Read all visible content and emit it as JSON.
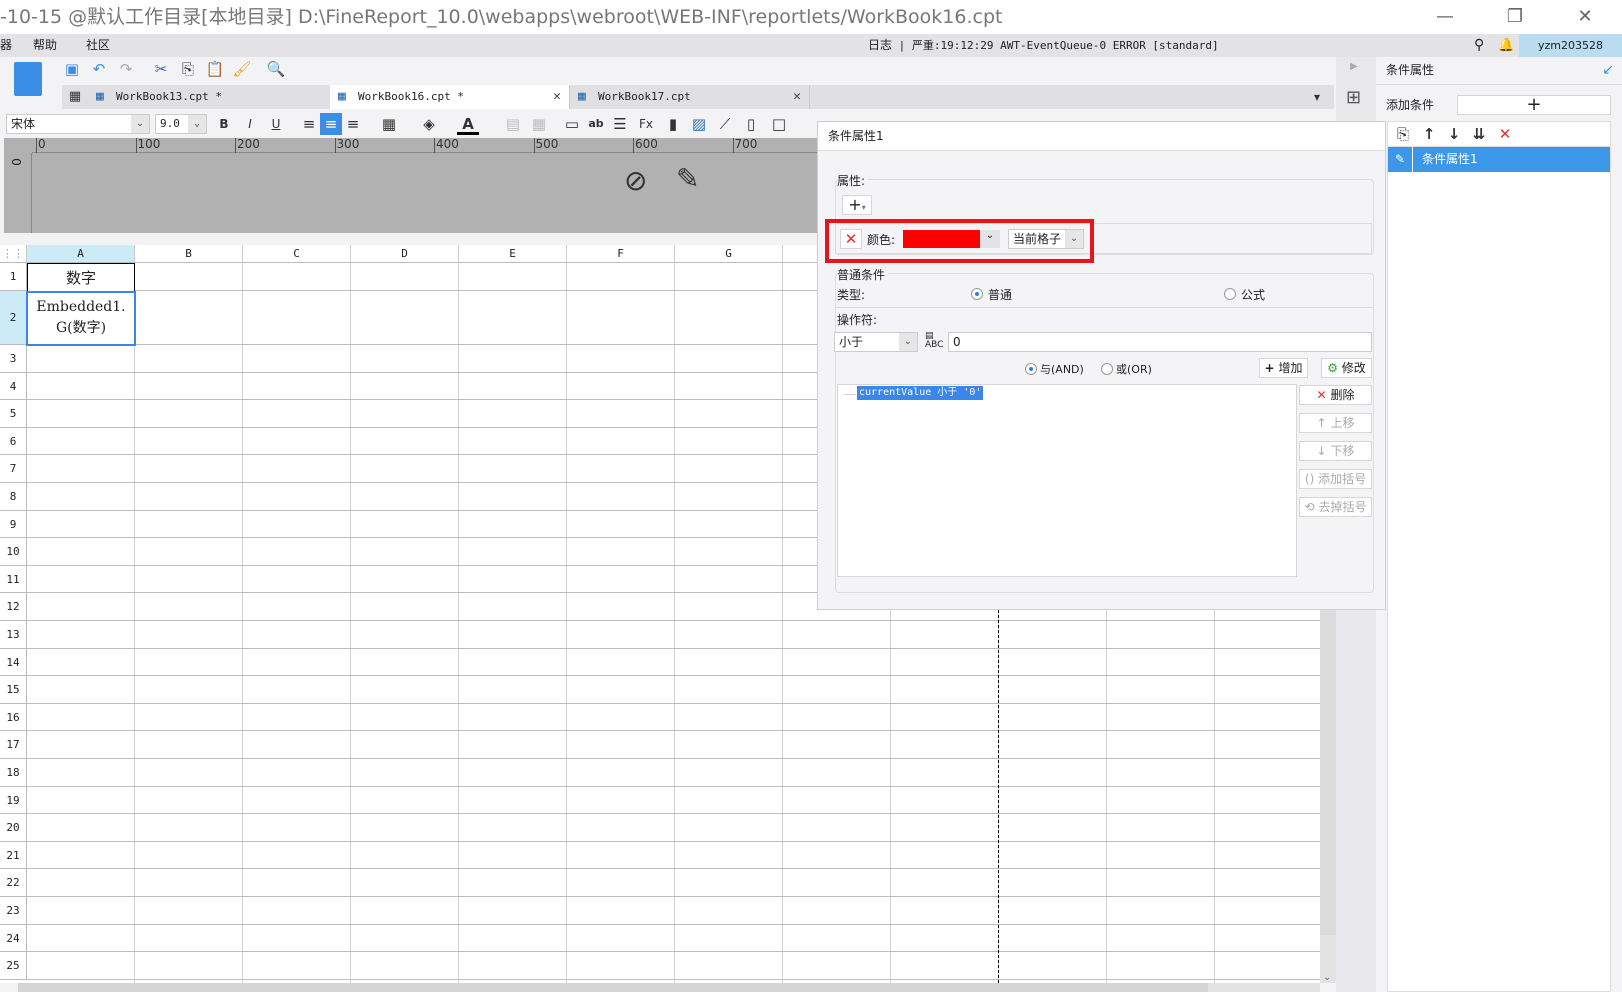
{
  "window": {
    "title": "-10-15 @默认工作目录[本地目录]",
    "path": "D:\\FineReport_10.0\\webapps\\webroot\\WEB-INF\\reportlets/WorkBook16.cpt"
  },
  "menu": {
    "items": [
      "器",
      "帮助",
      "社区"
    ],
    "log_label": "日志",
    "log_text": "严重:19:12:29 AWT-EventQueue-0 ERROR [standard]",
    "user": "yzm203528"
  },
  "tabs": [
    {
      "label": "WorkBook13.cpt *",
      "active": false
    },
    {
      "label": "WorkBook16.cpt *",
      "active": true
    },
    {
      "label": "WorkBook17.cpt",
      "active": false
    }
  ],
  "format": {
    "font": "宋体",
    "size": "9.0"
  },
  "ruler": {
    "ticks": [
      "0",
      "100",
      "200",
      "300",
      "400",
      "500",
      "600",
      "700"
    ],
    "vtick": "0"
  },
  "grid": {
    "columns": [
      "A",
      "B",
      "C",
      "D",
      "E",
      "F",
      "G",
      "",
      "",
      "",
      "",
      "",
      ""
    ],
    "rows": [
      "1",
      "2",
      "3",
      "4",
      "5",
      "6",
      "7",
      "8",
      "9",
      "10",
      "11",
      "12",
      "13",
      "14",
      "15",
      "16",
      "17",
      "18",
      "19",
      "20",
      "21",
      "22",
      "23",
      "24",
      "25"
    ],
    "cells": {
      "A1": "数字",
      "A2": "Embedded1.\nG(数字)"
    }
  },
  "dialog": {
    "title": "条件属性1",
    "attr_label": "属性:",
    "color_label": "颜色:",
    "color_value": "#ff0000",
    "scope": "当前格子",
    "common_label": "普通条件",
    "type_label": "类型:",
    "type_options": [
      {
        "label": "普通",
        "selected": true
      },
      {
        "label": "公式",
        "selected": false
      }
    ],
    "op_label": "操作符:",
    "op_value": "小于",
    "value": "0",
    "logic": [
      {
        "label": "与(AND)",
        "selected": true
      },
      {
        "label": "或(OR)",
        "selected": false
      }
    ],
    "add_label": "增加",
    "modify_label": "修改",
    "conditions": [
      "currentValue 小于 '0'"
    ],
    "side_buttons": [
      {
        "label": "删除",
        "enabled": true,
        "icon": "close-icon"
      },
      {
        "label": "上移",
        "enabled": false,
        "icon": "arrow-up-icon"
      },
      {
        "label": "下移",
        "enabled": false,
        "icon": "arrow-down-icon"
      },
      {
        "label": "添加括号",
        "enabled": false,
        "icon": "parentheses-icon"
      },
      {
        "label": "去掉括号",
        "enabled": false,
        "icon": "remove-parentheses-icon"
      }
    ]
  },
  "right_panel": {
    "title": "条件属性",
    "add_label": "添加条件",
    "items": [
      "条件属性1"
    ]
  },
  "colors": {
    "accent": "#3d97e8",
    "highlight_box": "#e8141c",
    "selection": "#3b86e8"
  }
}
